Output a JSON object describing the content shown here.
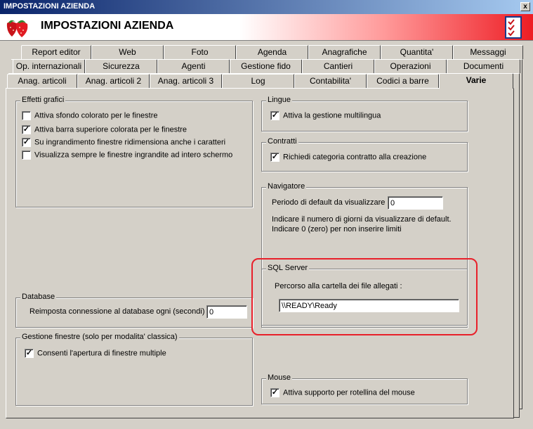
{
  "window": {
    "title": "IMPOSTAZIONI AZIENDA",
    "close_label": "x"
  },
  "header": {
    "title": "IMPOSTAZIONI AZIENDA"
  },
  "tabs": {
    "row1": [
      "Report editor",
      "Web",
      "Foto",
      "Agenda",
      "Anagrafiche",
      "Quantita'",
      "Messaggi"
    ],
    "row2": [
      "Op. internazionali",
      "Sicurezza",
      "Agenti",
      "Gestione fido",
      "Cantieri",
      "Operazioni",
      "Documenti"
    ],
    "row3": [
      "Anag. articoli",
      "Anag. articoli 2",
      "Anag. articoli 3",
      "Log",
      "Contabilita'",
      "Codici a barre",
      "Varie"
    ],
    "active": "Varie"
  },
  "effetti": {
    "title": "Effetti grafici",
    "items": [
      {
        "label": "Attiva sfondo colorato per le finestre",
        "checked": false
      },
      {
        "label": "Attiva barra superiore colorata per le finestre",
        "checked": true
      },
      {
        "label": "Su ingrandimento finestre ridimensiona anche i caratteri",
        "checked": true
      },
      {
        "label": "Visualizza sempre le finestre ingrandite ad intero schermo",
        "checked": false
      }
    ]
  },
  "database": {
    "title": "Database",
    "label": "Reimposta connessione al database ogni (secondi) :",
    "value": "0"
  },
  "gestione_finestre": {
    "title": "Gestione finestre (solo per modalita' classica)",
    "item": {
      "label": "Consenti l'apertura di finestre multiple",
      "checked": true
    }
  },
  "lingue": {
    "title": "Lingue",
    "item": {
      "label": "Attiva la gestione multilingua",
      "checked": true
    }
  },
  "contratti": {
    "title": "Contratti",
    "item": {
      "label": "Richiedi categoria contratto alla creazione",
      "checked": true
    }
  },
  "navigatore": {
    "title": "Navigatore",
    "label": "Periodo di default da visualizzare :",
    "value": "0",
    "note1": "Indicare il numero di giorni da visualizzare di default.",
    "note2": "Indicare 0 (zero) per non inserire limiti"
  },
  "sql_server": {
    "title": "SQL Server",
    "label": "Percorso alla cartella dei file allegati :",
    "value": "\\\\READY\\Ready"
  },
  "mouse": {
    "title": "Mouse",
    "item": {
      "label": "Attiva supporto per rotellina del mouse",
      "checked": true
    }
  },
  "colors": {
    "highlight": "#e8202a",
    "titlebar": "#0a246a"
  }
}
